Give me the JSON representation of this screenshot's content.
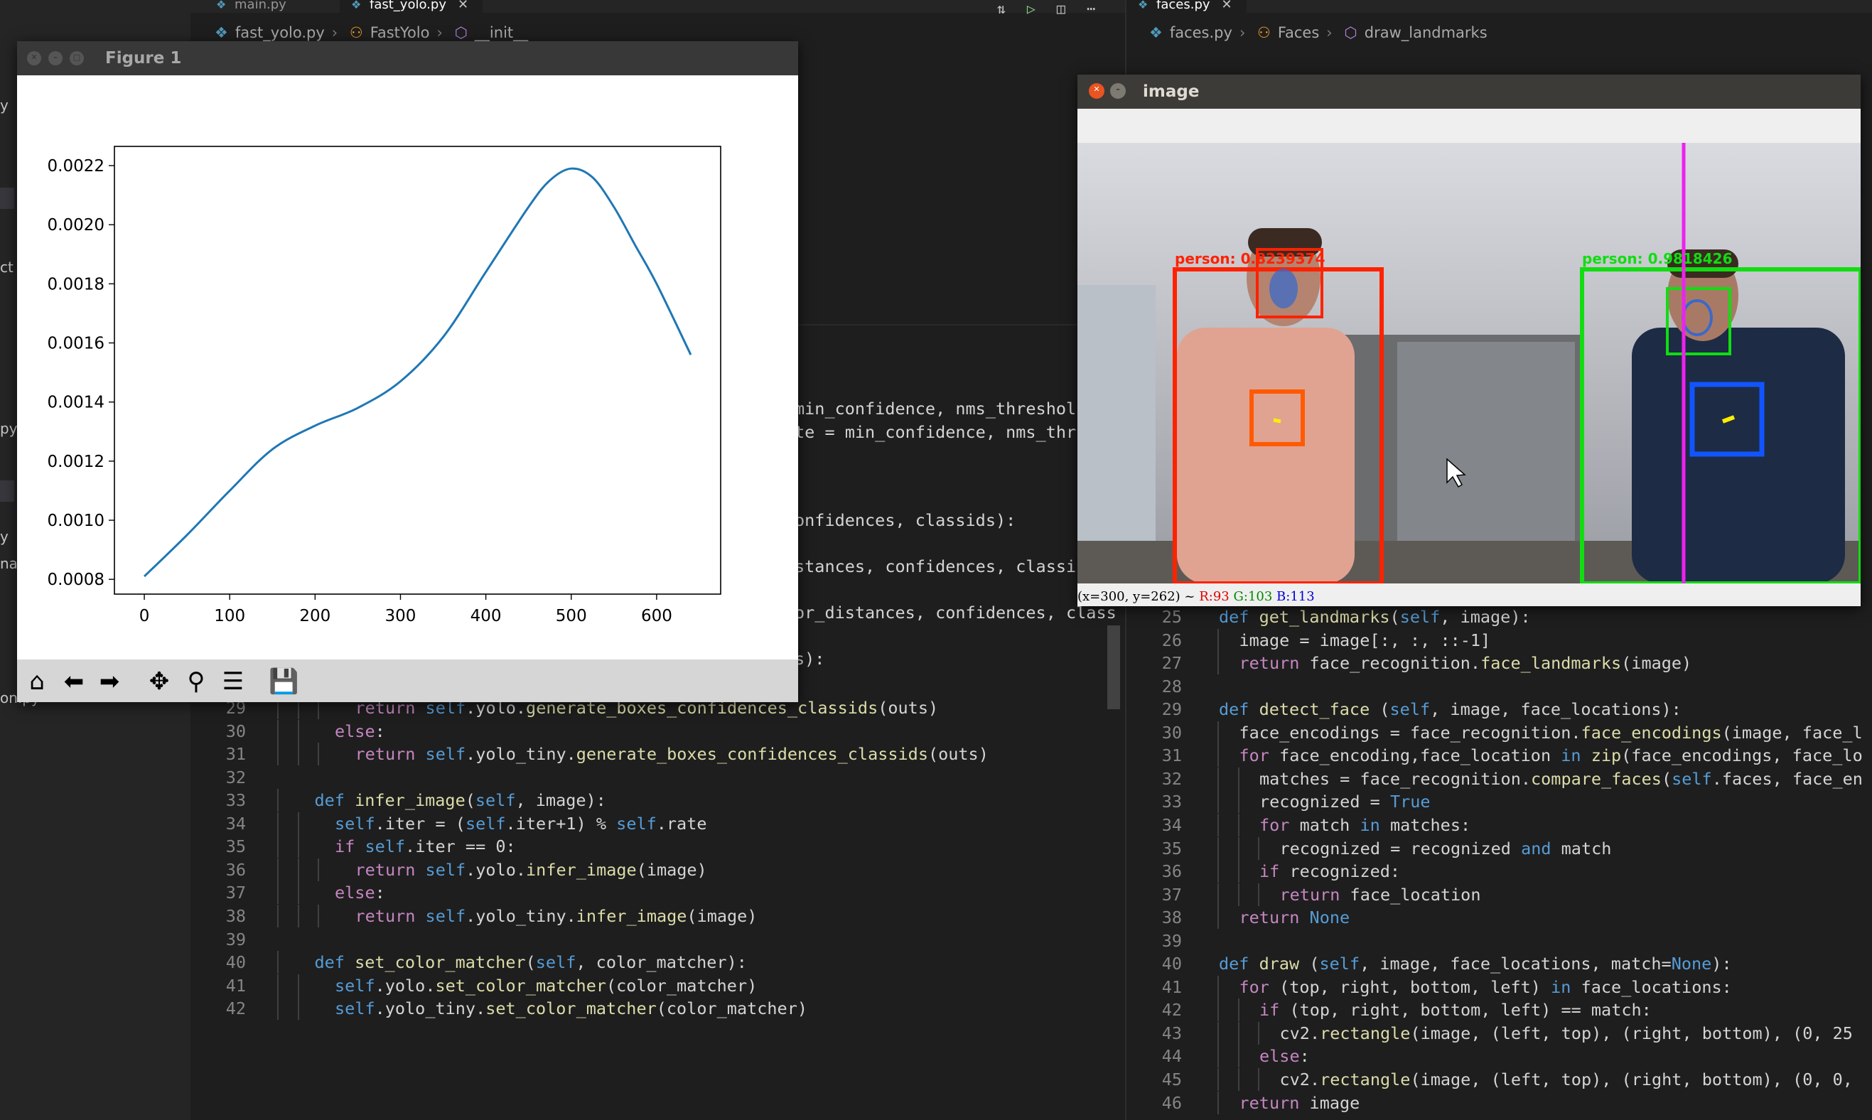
{
  "left_editor": {
    "tabs": [
      {
        "name": "main.py",
        "active": false
      },
      {
        "name": "fast_yolo.py",
        "active": true
      }
    ],
    "close_glyph": "✕",
    "breadcrumbs": [
      "fast_yolo.py",
      "FastYolo",
      "__init__"
    ],
    "visible_fragments": [
      {
        "text": "min_confidence, nms_threshol",
        "top": 575
      },
      {
        "text": "te = min_confidence, nms_thr",
        "top": 608
      },
      {
        "text": "onfidences, classids):",
        "top": 732
      },
      {
        "text": "stances, confidences, classi",
        "top": 797
      },
      {
        "text": "or_distances, confidences, class",
        "top": 862
      },
      {
        "text": "s):",
        "top": 927
      }
    ],
    "lines": [
      {
        "n": "29",
        "indent": 3,
        "tokens": [
          [
            "cf",
            "return "
          ],
          [
            "sf",
            "self"
          ],
          [
            "",
            "."
          ],
          [
            "",
            "yolo."
          ],
          [
            "fn",
            "generate_boxes_confidences_classids"
          ],
          [
            "",
            "(outs)"
          ]
        ]
      },
      {
        "n": "30",
        "indent": 2,
        "tokens": [
          [
            "cf",
            "else"
          ],
          [
            "",
            ":"
          ]
        ]
      },
      {
        "n": "31",
        "indent": 3,
        "tokens": [
          [
            "cf",
            "return "
          ],
          [
            "sf",
            "self"
          ],
          [
            "",
            ".yolo_tiny."
          ],
          [
            "fn",
            "generate_boxes_confidences_classids"
          ],
          [
            "",
            "(outs)"
          ]
        ]
      },
      {
        "n": "32",
        "indent": 0,
        "tokens": []
      },
      {
        "n": "33",
        "indent": 1,
        "tokens": [
          [
            "kw",
            "def "
          ],
          [
            "fn",
            "infer_image"
          ],
          [
            "",
            "("
          ],
          [
            "sf",
            "self"
          ],
          [
            "",
            ", image):"
          ]
        ]
      },
      {
        "n": "34",
        "indent": 2,
        "tokens": [
          [
            "sf",
            "self"
          ],
          [
            "",
            ".iter = ("
          ],
          [
            "sf",
            "self"
          ],
          [
            "",
            ".iter+1) % "
          ],
          [
            "sf",
            "self"
          ],
          [
            "",
            ".rate"
          ]
        ]
      },
      {
        "n": "35",
        "indent": 2,
        "tokens": [
          [
            "cf",
            "if "
          ],
          [
            "sf",
            "self"
          ],
          [
            "",
            ".iter == 0:"
          ]
        ]
      },
      {
        "n": "36",
        "indent": 3,
        "tokens": [
          [
            "cf",
            "return "
          ],
          [
            "sf",
            "self"
          ],
          [
            "",
            ".yolo."
          ],
          [
            "fn",
            "infer_image"
          ],
          [
            "",
            "(image)"
          ]
        ]
      },
      {
        "n": "37",
        "indent": 2,
        "tokens": [
          [
            "cf",
            "else"
          ],
          [
            "",
            ":"
          ]
        ]
      },
      {
        "n": "38",
        "indent": 3,
        "tokens": [
          [
            "cf",
            "return "
          ],
          [
            "sf",
            "self"
          ],
          [
            "",
            ".yolo_tiny."
          ],
          [
            "fn",
            "infer_image"
          ],
          [
            "",
            "(image)"
          ]
        ]
      },
      {
        "n": "39",
        "indent": 0,
        "tokens": []
      },
      {
        "n": "40",
        "indent": 1,
        "tokens": [
          [
            "kw",
            "def "
          ],
          [
            "fn",
            "set_color_matcher"
          ],
          [
            "",
            "("
          ],
          [
            "sf",
            "self"
          ],
          [
            "",
            ", color_matcher):"
          ]
        ]
      },
      {
        "n": "41",
        "indent": 2,
        "tokens": [
          [
            "sf",
            "self"
          ],
          [
            "",
            ".yolo."
          ],
          [
            "fn",
            "set_color_matcher"
          ],
          [
            "",
            "(color_matcher)"
          ]
        ]
      },
      {
        "n": "42",
        "indent": 2,
        "tokens": [
          [
            "sf",
            "self"
          ],
          [
            "",
            ".yolo_tiny."
          ],
          [
            "fn",
            "set_color_matcher"
          ],
          [
            "",
            "(color_matcher)"
          ]
        ]
      }
    ]
  },
  "sidebar_fragments": [
    {
      "text": "y",
      "top": 150
    },
    {
      "text": "ct",
      "top": 378
    },
    {
      "text": "py",
      "top": 605
    },
    {
      "text": "y",
      "top": 757
    },
    {
      "text": "na",
      "top": 795
    },
    {
      "text": "on.py",
      "top": 984
    }
  ],
  "right_editor": {
    "tab": "faces.py",
    "breadcrumbs": [
      "faces.py",
      "Faces",
      "draw_landmarks"
    ],
    "first_line": "1",
    "lines": [
      {
        "n": "25",
        "indent": 0,
        "tokens": [
          [
            "kw",
            "def "
          ],
          [
            "fn",
            "get_landmarks"
          ],
          [
            "",
            "("
          ],
          [
            "sf",
            "self"
          ],
          [
            "",
            ", image):"
          ]
        ]
      },
      {
        "n": "26",
        "indent": 1,
        "tokens": [
          [
            "",
            "image = image[:, :, ::-1]"
          ]
        ]
      },
      {
        "n": "27",
        "indent": 1,
        "tokens": [
          [
            "cf",
            "return "
          ],
          [
            "",
            "face_recognition."
          ],
          [
            "fn",
            "face_landmarks"
          ],
          [
            "",
            "(image)"
          ]
        ]
      },
      {
        "n": "28",
        "indent": 0,
        "tokens": []
      },
      {
        "n": "29",
        "indent": 0,
        "tokens": [
          [
            "kw",
            "def "
          ],
          [
            "fn",
            "detect_face "
          ],
          [
            "",
            "("
          ],
          [
            "sf",
            "self"
          ],
          [
            "",
            ", image, face_locations):"
          ]
        ]
      },
      {
        "n": "30",
        "indent": 1,
        "tokens": [
          [
            "",
            "face_encodings = face_recognition."
          ],
          [
            "fn",
            "face_encodings"
          ],
          [
            "",
            "(image, face_l"
          ]
        ]
      },
      {
        "n": "31",
        "indent": 1,
        "tokens": [
          [
            "cf",
            "for "
          ],
          [
            "",
            "face_encoding,face_location "
          ],
          [
            "kw",
            "in "
          ],
          [
            "fn",
            "zip"
          ],
          [
            "",
            "(face_encodings, face_lo"
          ]
        ]
      },
      {
        "n": "32",
        "indent": 2,
        "tokens": [
          [
            "",
            "matches = face_recognition."
          ],
          [
            "fn",
            "compare_faces"
          ],
          [
            "",
            "("
          ],
          [
            "sf",
            "self"
          ],
          [
            "",
            ".faces, face_en"
          ]
        ]
      },
      {
        "n": "33",
        "indent": 2,
        "tokens": [
          [
            "",
            "recognized = "
          ],
          [
            "kw",
            "True"
          ]
        ]
      },
      {
        "n": "34",
        "indent": 2,
        "tokens": [
          [
            "cf",
            "for "
          ],
          [
            "",
            "match "
          ],
          [
            "kw",
            "in "
          ],
          [
            "",
            "matches:"
          ]
        ]
      },
      {
        "n": "35",
        "indent": 3,
        "tokens": [
          [
            "",
            "recognized = recognized "
          ],
          [
            "kw",
            "and "
          ],
          [
            "",
            "match"
          ]
        ]
      },
      {
        "n": "36",
        "indent": 2,
        "tokens": [
          [
            "cf",
            "if "
          ],
          [
            "",
            "recognized:"
          ]
        ]
      },
      {
        "n": "37",
        "indent": 3,
        "tokens": [
          [
            "cf",
            "return "
          ],
          [
            "",
            "face_location"
          ]
        ]
      },
      {
        "n": "38",
        "indent": 1,
        "tokens": [
          [
            "cf",
            "return "
          ],
          [
            "kw",
            "None"
          ]
        ]
      },
      {
        "n": "39",
        "indent": 0,
        "tokens": []
      },
      {
        "n": "40",
        "indent": 0,
        "tokens": [
          [
            "kw",
            "def "
          ],
          [
            "fn",
            "draw "
          ],
          [
            "",
            "("
          ],
          [
            "sf",
            "self"
          ],
          [
            "",
            ", image, face_locations, match="
          ],
          [
            "kw",
            "None"
          ],
          [
            "",
            "):"
          ]
        ]
      },
      {
        "n": "41",
        "indent": 1,
        "tokens": [
          [
            "cf",
            "for "
          ],
          [
            "",
            "(top, right, bottom, left) "
          ],
          [
            "kw",
            "in "
          ],
          [
            "",
            "face_locations:"
          ]
        ]
      },
      {
        "n": "42",
        "indent": 2,
        "tokens": [
          [
            "cf",
            "if "
          ],
          [
            "",
            "(top, right, bottom, left) == match:"
          ]
        ]
      },
      {
        "n": "43",
        "indent": 3,
        "tokens": [
          [
            "",
            "cv2."
          ],
          [
            "fn",
            "rectangle"
          ],
          [
            "",
            "(image, (left, top), (right, bottom), (0, 25"
          ]
        ]
      },
      {
        "n": "44",
        "indent": 2,
        "tokens": [
          [
            "cf",
            "else"
          ],
          [
            "",
            ":"
          ]
        ]
      },
      {
        "n": "45",
        "indent": 3,
        "tokens": [
          [
            "",
            "cv2."
          ],
          [
            "fn",
            "rectangle"
          ],
          [
            "",
            "(image, (left, top), (right, bottom), (0, 0,"
          ]
        ]
      },
      {
        "n": "46",
        "indent": 1,
        "tokens": [
          [
            "cf",
            "return "
          ],
          [
            "",
            "image"
          ]
        ]
      }
    ]
  },
  "figure_window": {
    "title": "Figure 1",
    "toolbar_icons": [
      "home-icon",
      "back-arrow-icon",
      "forward-arrow-icon",
      "pan-icon",
      "zoom-icon",
      "configure-subplots-icon",
      "save-icon"
    ]
  },
  "chart_data": {
    "type": "line",
    "title": "",
    "xlabel": "",
    "ylabel": "",
    "xlim": [
      -35,
      675
    ],
    "ylim": [
      0.00075,
      0.002265
    ],
    "xticks": [
      0,
      100,
      200,
      300,
      400,
      500,
      600
    ],
    "yticks": [
      0.0008,
      0.001,
      0.0012,
      0.0014,
      0.0016,
      0.0018,
      0.002,
      0.0022
    ],
    "ytick_labels": [
      "0.0008",
      "0.0010",
      "0.0012",
      "0.0014",
      "0.0016",
      "0.0018",
      "0.0020",
      "0.0022"
    ],
    "grid": false,
    "color": "#1f77b4",
    "x": [
      0,
      50,
      100,
      150,
      200,
      250,
      300,
      350,
      400,
      450,
      475,
      500,
      525,
      550,
      575,
      600,
      640
    ],
    "y": [
      0.00081,
      0.00095,
      0.0011,
      0.00124,
      0.00132,
      0.00138,
      0.00147,
      0.00162,
      0.00184,
      0.00206,
      0.00215,
      0.00219,
      0.00216,
      0.00206,
      0.00193,
      0.0018,
      0.00156
    ]
  },
  "image_window": {
    "title": "image",
    "status": {
      "coords": "(x=300, y=262) ~",
      "r": "R:93",
      "g": "G:103",
      "b": "B:113"
    },
    "labels": [
      {
        "text": "person: 0.8239374",
        "color": "#ff2200"
      },
      {
        "text": "person: 0.9818426",
        "color": "#00dd00"
      }
    ],
    "colors": {
      "red": "#ff2200",
      "orange": "#ff5a00",
      "green": "#11dd11",
      "blue": "#1155ff",
      "magenta": "#ee22ee"
    }
  }
}
